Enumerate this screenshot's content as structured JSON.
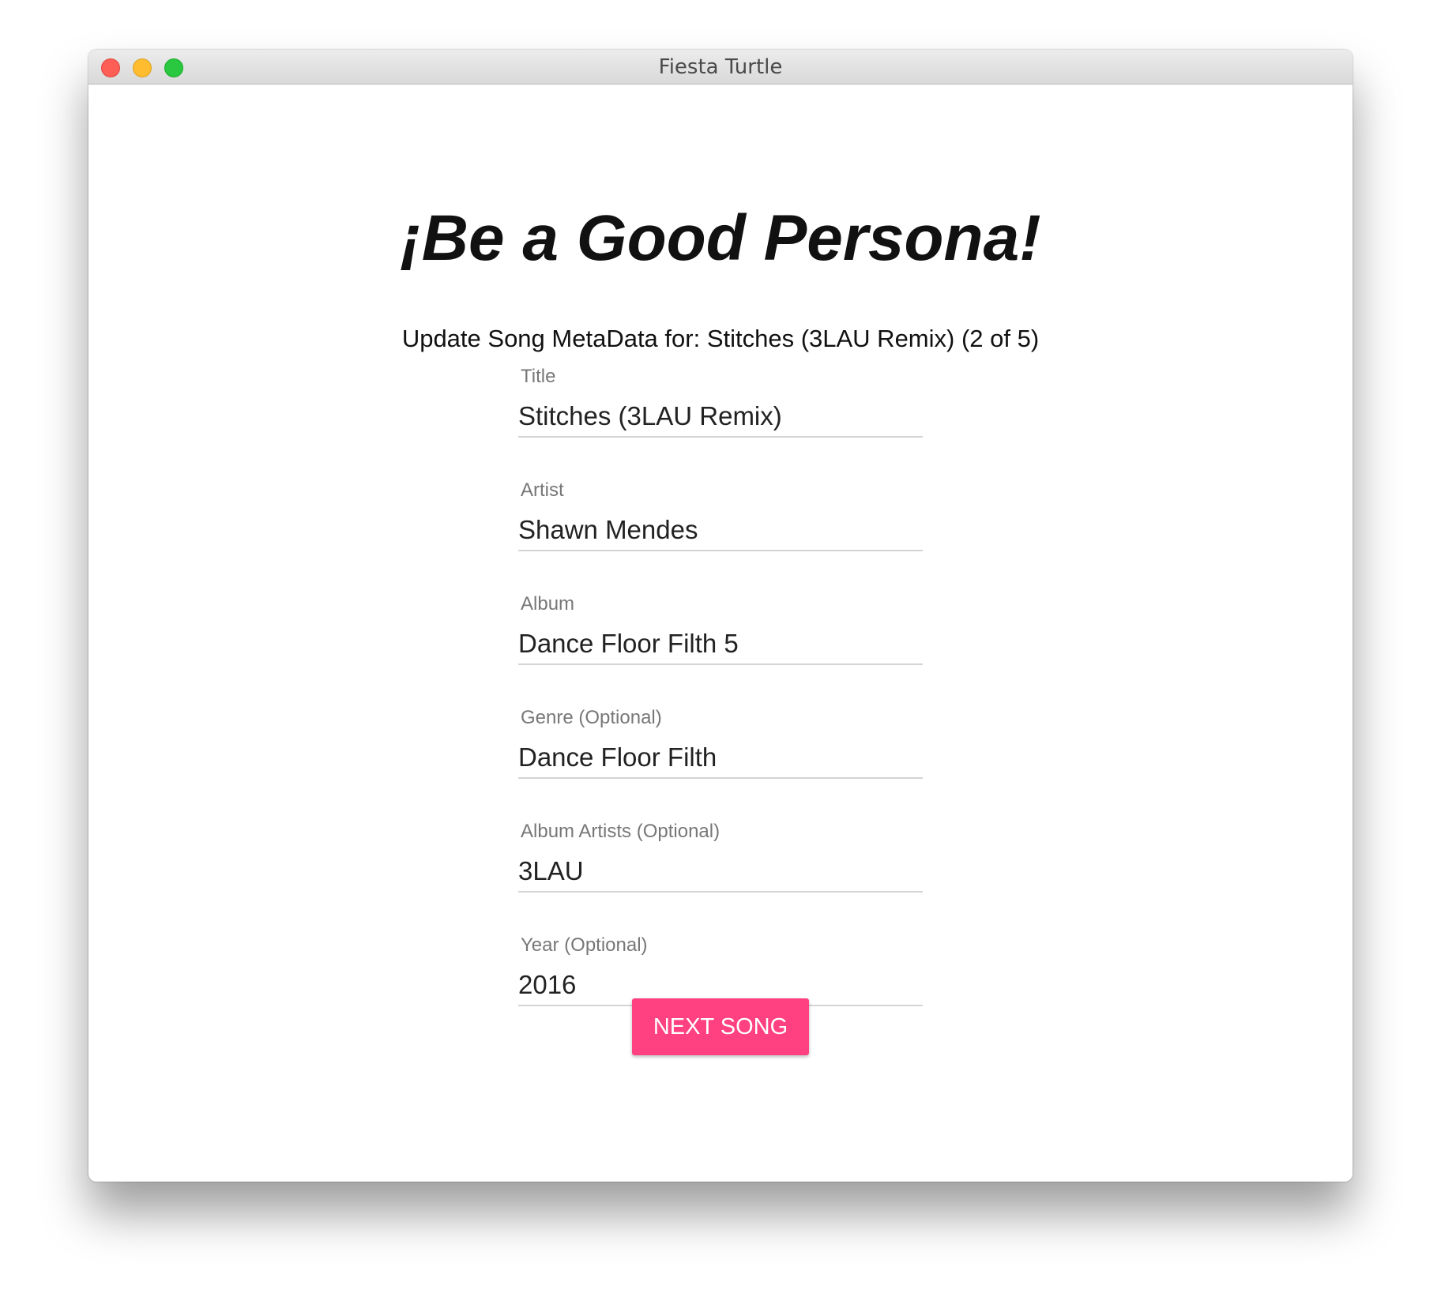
{
  "window": {
    "title": "Fiesta Turtle",
    "controls": [
      "close-icon",
      "minimize-icon",
      "maximize-icon"
    ]
  },
  "page": {
    "heading": "¡Be a Good Persona!",
    "subtitle": "Update Song MetaData for: Stitches (3LAU Remix) (2 of 5)"
  },
  "form": {
    "fields": [
      {
        "label": "Title",
        "value": "Stitches (3LAU Remix)"
      },
      {
        "label": "Artist",
        "value": "Shawn Mendes"
      },
      {
        "label": "Album",
        "value": "Dance Floor Filth 5"
      },
      {
        "label": "Genre (Optional)",
        "value": "Dance Floor Filth"
      },
      {
        "label": "Album Artists (Optional)",
        "value": "3LAU"
      },
      {
        "label": "Year (Optional)",
        "value": "2016"
      }
    ],
    "next_button_label": "NEXT SONG"
  },
  "colors": {
    "accent": "#ff4081",
    "close": "#fd5f57",
    "minimize": "#febc2e",
    "maximize": "#29c840"
  }
}
